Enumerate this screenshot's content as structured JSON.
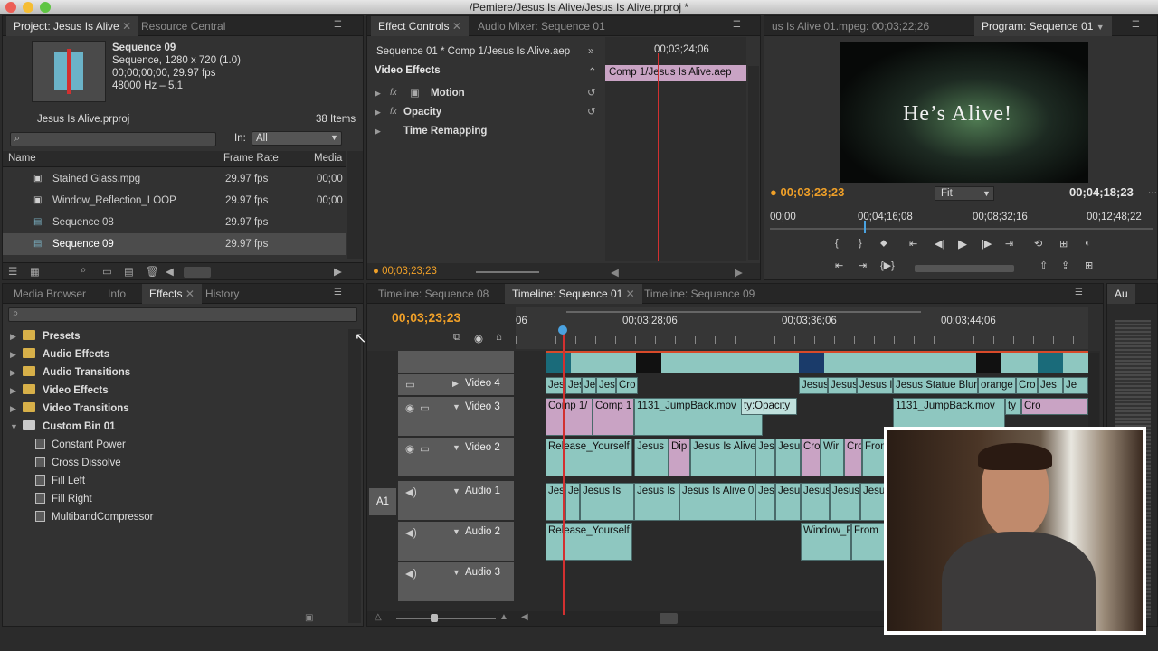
{
  "window": {
    "title": "/Pemiere/Jesus Is Alive/Jesus Is Alive.prproj *"
  },
  "project_panel": {
    "tabs": [
      "Project: Jesus Is Alive",
      "Resource Central"
    ],
    "preview": {
      "name": "Sequence 09",
      "line1": "Sequence, 1280 x 720 (1.0)",
      "line2": "00;00;00;00, 29.97 fps",
      "line3": "48000 Hz – 5.1"
    },
    "project_file": "Jesus Is Alive.prproj",
    "item_count": "38 Items",
    "in_label": "In:",
    "in_value": "All",
    "columns": [
      "Name",
      "Frame Rate",
      "Media"
    ],
    "rows": [
      {
        "name": "Stained Glass.mpg",
        "rate": "29.97 fps",
        "media": "00;00"
      },
      {
        "name": "Window_Reflection_LOOP",
        "rate": "29.97 fps",
        "media": "00;00"
      },
      {
        "name": "Sequence 08",
        "rate": "29.97 fps",
        "media": ""
      },
      {
        "name": "Sequence 09",
        "rate": "29.97 fps",
        "media": ""
      }
    ]
  },
  "effect_controls": {
    "tabs": [
      "Effect Controls",
      "Audio Mixer: Sequence 01"
    ],
    "header": "Sequence 01 * Comp 1/Jesus Is Alive.aep",
    "timecode_top": "00;03;24;06",
    "clip_label": "Comp 1/Jesus Is Alive.aep",
    "section": "Video Effects",
    "effects": [
      "Motion",
      "Opacity",
      "Time Remapping"
    ],
    "fx_label": "fx",
    "timecode_bottom": "00;03;23;23"
  },
  "program_monitor": {
    "source_tab": "us Is Alive 01.mpeg: 00;03;22;26",
    "tab": "Program: Sequence 01",
    "video_text": "He’s Alive!",
    "current_tc": "00;03;23;23",
    "fit": "Fit",
    "duration": "00;04;18;23",
    "ruler": [
      "00;00",
      "00;04;16;08",
      "00;08;32;16",
      "00;12;48;22"
    ]
  },
  "effects_panel": {
    "tabs": [
      "Media Browser",
      "Info",
      "Effects",
      "History"
    ],
    "folders": [
      "Presets",
      "Audio Effects",
      "Audio Transitions",
      "Video Effects",
      "Video Transitions",
      "Custom Bin 01"
    ],
    "bin_items": [
      "Constant Power",
      "Cross Dissolve",
      "Fill Left",
      "Fill Right",
      "MultibandCompressor"
    ]
  },
  "timeline": {
    "tabs": [
      "Timeline: Sequence 08",
      "Timeline: Sequence 01",
      "Timeline: Sequence 09"
    ],
    "timecode": "00;03;23;23",
    "ruler": [
      "06",
      "00;03;28;06",
      "00;03;36;06",
      "00;03;44;06"
    ],
    "tracks": [
      "Video 4",
      "Video 3",
      "Video 2",
      "Audio 1",
      "Audio 2",
      "Audio 3"
    ],
    "a1_label": "A1",
    "clips": {
      "v4": [
        "Jes",
        "Jes",
        "Je",
        "Jes",
        "Cro",
        "Jesus",
        "Jesus",
        "Jesus I",
        "Jesus Statue Blur",
        "orange",
        "Cro",
        "Jes",
        "Je"
      ],
      "v3": [
        "Comp 1/",
        "Comp 1",
        "1131_JumpBack.mov",
        "ty:Opacity",
        "1131_JumpBack.mov",
        "ty",
        "Cro"
      ],
      "v2": [
        "Release_Yourself",
        "Jesus I",
        "Dip",
        "Jesus Is Alive",
        "Jes",
        "Jesu",
        "Cro",
        "Wir",
        "Cro",
        "From"
      ],
      "a1": [
        "Jes",
        "Je",
        "Jesus Is",
        "Jesus Is",
        "Jesus Is Alive 0",
        "Jes",
        "Jesu",
        "Jesus",
        "Jesus",
        "Jesu"
      ],
      "a2": [
        "Release_Yourself",
        "Window_F",
        "From"
      ]
    },
    "side_tab": "Au"
  },
  "colors": {
    "accent": "#f0a028",
    "playhead": "#d23030",
    "video_clip": "#8ec7c0",
    "comp_clip": "#c9a3c4"
  }
}
